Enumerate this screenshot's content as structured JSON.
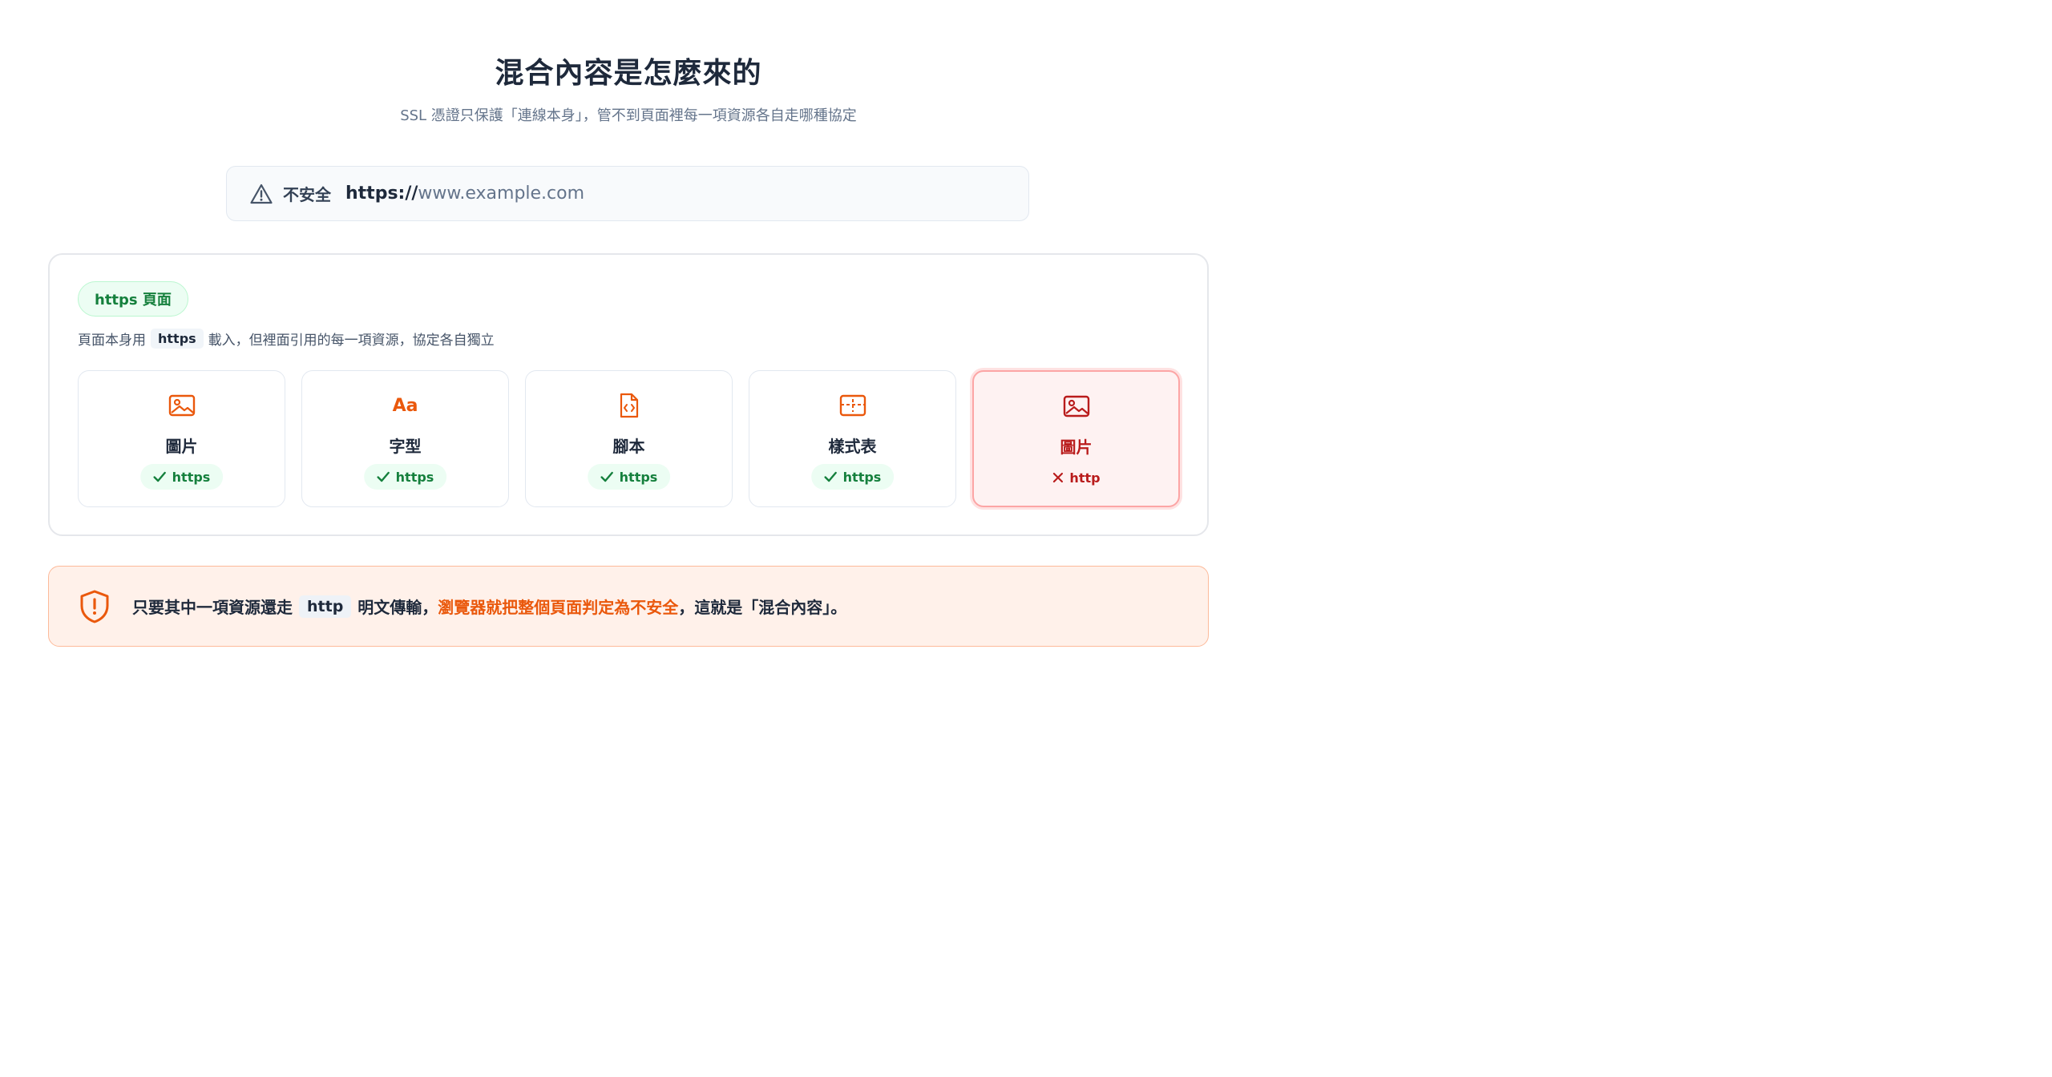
{
  "header": {
    "title": "混合內容是怎麼來的",
    "subtitle": "SSL 憑證只保護「連線本身」，管不到頁面裡每一項資源各自走哪種協定"
  },
  "address_bar": {
    "warning_icon": "warning-triangle-icon",
    "insecure_label": "不安全",
    "url_scheme": "https://",
    "url_host": "www.example.com"
  },
  "page_panel": {
    "badge": "https 頁面",
    "desc_before": "頁面本身用",
    "desc_code": "https",
    "desc_after": "載入，但裡面引用的每一項資源，協定各自獨立",
    "resources": [
      {
        "icon": "image-icon",
        "name": "圖片",
        "protocol": "https",
        "secure": true
      },
      {
        "icon": "font-icon",
        "icon_text": "Aa",
        "name": "字型",
        "protocol": "https",
        "secure": true
      },
      {
        "icon": "script-file-icon",
        "name": "腳本",
        "protocol": "https",
        "secure": true
      },
      {
        "icon": "stylesheet-icon",
        "name": "樣式表",
        "protocol": "https",
        "secure": true
      },
      {
        "icon": "image-icon",
        "name": "圖片",
        "protocol": "http",
        "secure": false
      }
    ]
  },
  "alert": {
    "icon": "shield-exclamation-icon",
    "text_before": "只要其中一項資源還走",
    "code": "http",
    "text_middle": "明文傳輸，",
    "highlight": "瀏覽器就把整個頁面判定為不安全",
    "text_after": "，這就是「混合內容」。"
  },
  "colors": {
    "accent_orange": "#ea580c",
    "secure_green": "#15803d",
    "insecure_red": "#b91c1c",
    "alert_bg": "#fff1ea"
  }
}
